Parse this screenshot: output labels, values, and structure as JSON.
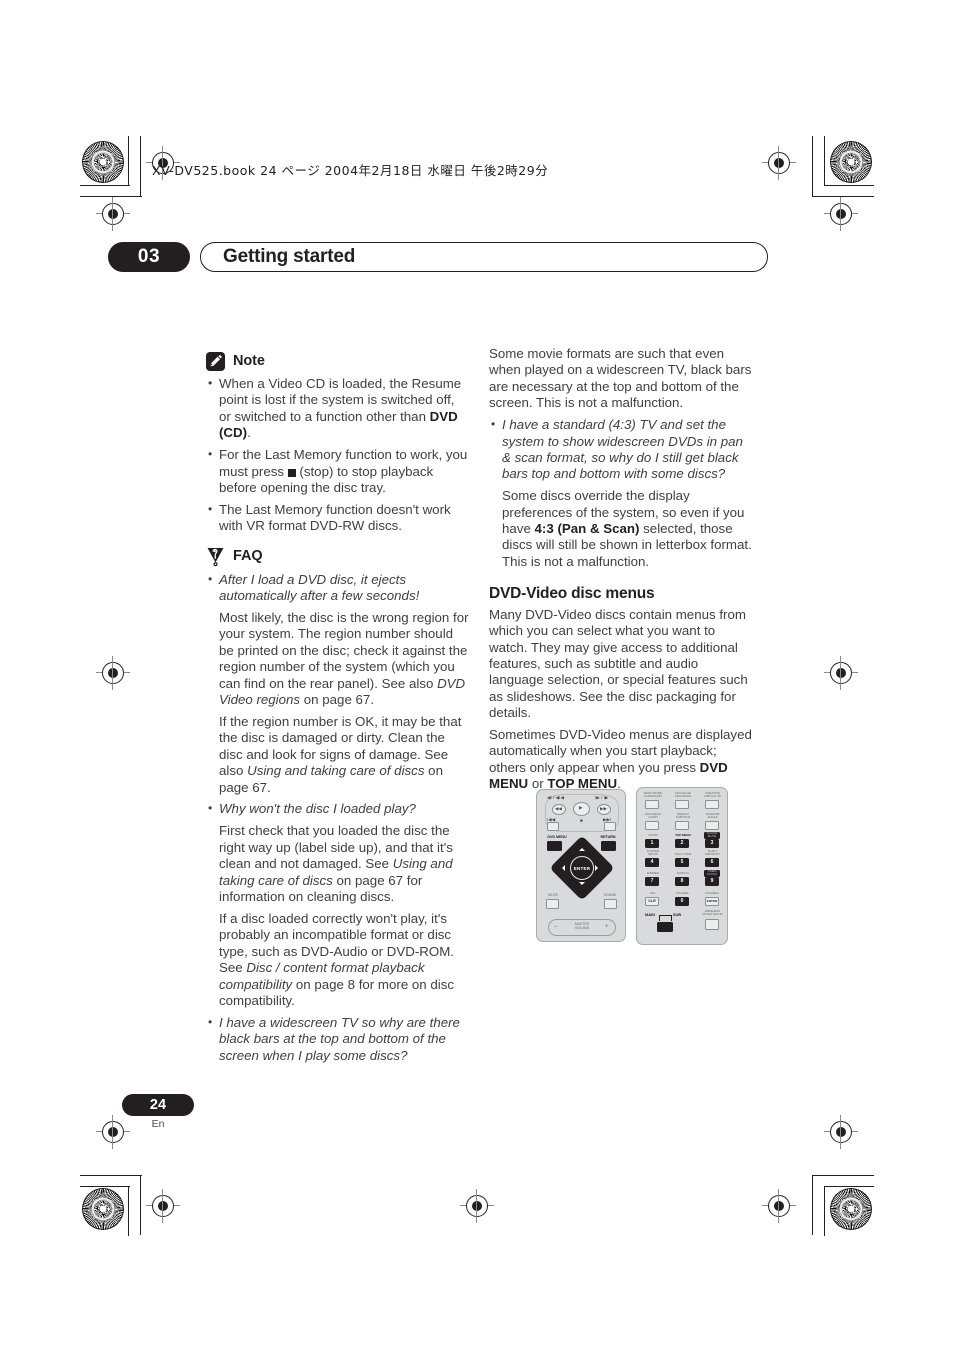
{
  "header": {
    "jp_line": "XV-DV525.book 24 ページ 2004年2月18日 水曜日 午後2時29分"
  },
  "chapter": {
    "number": "03",
    "title": "Getting started"
  },
  "footer": {
    "page_number": "24",
    "language": "En"
  },
  "left_column": {
    "note": {
      "icon": "pencil-icon",
      "heading": "Note",
      "bullets": [
        {
          "segments": [
            {
              "text": "When a Video CD is loaded, the Resume point is lost if the system is switched off, or switched to a function other than ",
              "style": "normal"
            },
            {
              "text": "DVD (CD)",
              "style": "bold"
            },
            {
              "text": ".",
              "style": "normal"
            }
          ]
        },
        {
          "segments": [
            {
              "text": "For the Last Memory function to work, you must press ",
              "style": "normal"
            },
            {
              "text": "■",
              "style": "glyph"
            },
            {
              "text": " (stop) to stop playback before opening the disc tray.",
              "style": "normal"
            }
          ]
        },
        {
          "segments": [
            {
              "text": "The Last Memory function doesn't work with VR format DVD-RW discs.",
              "style": "normal"
            }
          ]
        }
      ]
    },
    "faq": {
      "icon": "faq-pennant-icon",
      "heading": "FAQ",
      "entries": [
        {
          "question": "After I load a DVD disc, it ejects automatically after a few seconds!",
          "answers": [
            [
              {
                "text": "Most likely, the disc is the wrong region for your system. The region number should be printed on the disc; check it against the region number of the system (which you can find on the rear panel). See also ",
                "style": "normal"
              },
              {
                "text": "DVD Video regions",
                "style": "italic"
              },
              {
                "text": " on page 67.",
                "style": "normal"
              }
            ],
            [
              {
                "text": "If the region number is OK, it may be that the disc is damaged or dirty. Clean the disc and look for signs of damage. See also ",
                "style": "normal"
              },
              {
                "text": "Using and taking care of discs",
                "style": "italic"
              },
              {
                "text": " on page 67.",
                "style": "normal"
              }
            ]
          ]
        },
        {
          "question": "Why won't the disc I loaded play?",
          "answers": [
            [
              {
                "text": "First check that you loaded the disc the right way up (label side up), and that it's clean and not damaged. See ",
                "style": "normal"
              },
              {
                "text": "Using and taking care of discs",
                "style": "italic"
              },
              {
                "text": " on page 67 for information on cleaning discs.",
                "style": "normal"
              }
            ],
            [
              {
                "text": "If a disc loaded correctly won't play, it's probably an incompatible format or disc type, such as DVD-Audio or DVD-ROM. See ",
                "style": "normal"
              },
              {
                "text": "Disc / content format playback compatibility",
                "style": "italic"
              },
              {
                "text": " on page 8 for more on disc compatibility.",
                "style": "normal"
              }
            ]
          ]
        },
        {
          "question": "I have a widescreen TV so why are there black bars at the top and bottom of the screen when I play some discs?",
          "answers": []
        }
      ]
    }
  },
  "right_column": {
    "continued_answer": [
      {
        "text": "Some movie formats are such that even when played on a widescreen TV, black bars are necessary at the top and bottom of the screen. This is not a malfunction.",
        "style": "normal"
      }
    ],
    "faq_entry": {
      "question": "I have a standard (4:3) TV and set the system to show widescreen DVDs in pan & scan format, so why do I still get black bars top and bottom with some discs?",
      "answer": [
        {
          "text": "Some discs override the display preferences of the system, so even if you have ",
          "style": "normal"
        },
        {
          "text": "4:3 (Pan & Scan)",
          "style": "bold"
        },
        {
          "text": " selected, those discs will still be shown in letterbox format. This is not a malfunction.",
          "style": "normal"
        }
      ]
    },
    "section": {
      "heading": "DVD-Video disc menus",
      "paragraphs": [
        [
          {
            "text": "Many DVD-Video discs contain menus from which you can select what you want to watch. They may give access to additional features, such as subtitle and audio language selection, or special features such as slideshows. See the disc packaging for details.",
            "style": "normal"
          }
        ],
        [
          {
            "text": "Sometimes DVD-Video menus are displayed automatically when you start playback; others only appear when you press ",
            "style": "normal"
          },
          {
            "text": "DVD MENU",
            "style": "bold"
          },
          {
            "text": " or ",
            "style": "normal"
          },
          {
            "text": "TOP MENU",
            "style": "bold"
          },
          {
            "text": ".",
            "style": "normal"
          }
        ]
      ]
    },
    "remote_illustration": {
      "name": "remote-control-diagram",
      "left_panel": {
        "transport_labels": [
          "◀I / ◀I◀",
          "I▶ / I▶"
        ],
        "buttons": [
          {
            "label": "DVD MENU",
            "emphasis": "dark"
          },
          {
            "label": "RETURN",
            "emphasis": "dark"
          },
          {
            "label": "MUTE",
            "emphasis": "light"
          },
          {
            "label": "SOUND",
            "emphasis": "light"
          }
        ],
        "center_button": "ENTER",
        "volume_label": "MASTER\nVOLUME",
        "volume_minus": "–",
        "volume_plus": "+"
      },
      "right_panel": {
        "rows": [
          [
            {
              "label": "BASS MODE\nSURROUND",
              "key": "",
              "style": "light"
            },
            {
              "label": "DIALOGUE\nADVANCED",
              "key": "",
              "style": "light"
            },
            {
              "label": "CREATIVE\nVIRTUAL 3D",
              "key": "",
              "style": "light"
            }
          ],
          [
            {
              "label": "PROGRAM\nAUDIO",
              "key": "",
              "style": "light"
            },
            {
              "label": "REPEAT\nSUBTITLE",
              "key": "",
              "style": "light"
            },
            {
              "label": "RANDOM\nANGLE",
              "key": "",
              "style": "light"
            }
          ],
          [
            {
              "label": "ZOOM",
              "key": "1",
              "style": "dark"
            },
            {
              "label": "TOP MENU",
              "key": "2",
              "style": "dark",
              "emphasis": "bold"
            },
            {
              "label": "SOUND\nMUTE",
              "key": "3",
              "style": "dark"
            }
          ],
          [
            {
              "label": "SYSTEM\nSETUP",
              "key": "4",
              "style": "dark"
            },
            {
              "label": "TEST TONE",
              "key": "5",
              "style": "dark"
            },
            {
              "label": "QUIET\nMIDNIGHT",
              "key": "6",
              "style": "dark"
            }
          ],
          [
            {
              "label": "DIMMER",
              "key": "7",
              "style": "dark"
            },
            {
              "label": "DISPLAY",
              "key": "8",
              "style": "dark"
            },
            {
              "label": "TIMER\nCLOCK",
              "key": "9",
              "style": "dark"
            }
          ],
          [
            {
              "label": "SR+",
              "key": "CLR",
              "style": "light"
            },
            {
              "label": "FOLDER–",
              "key": "0",
              "style": "dark"
            },
            {
              "label": "FOLDER+",
              "key": "ENTER",
              "style": "light"
            }
          ]
        ],
        "bottom": {
          "main_label": "MAIN",
          "sub_label": "SUB",
          "wireless_label": "WIRELESS\nROOM SETUP"
        }
      }
    }
  },
  "colors": {
    "ink": "#231f20",
    "body_text": "#3f3f3f",
    "remote_body": "#d9dadb",
    "remote_button_dark": "#231f20",
    "remote_button_light": "#eceded"
  }
}
